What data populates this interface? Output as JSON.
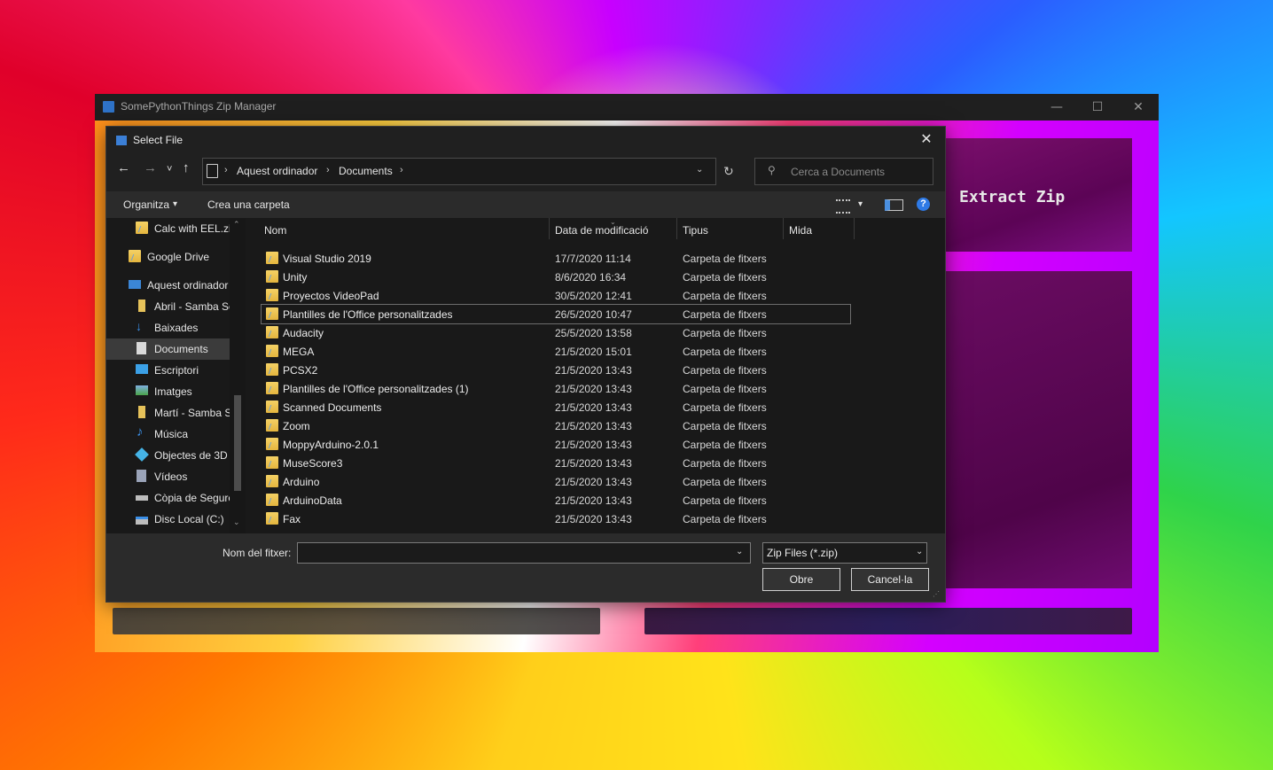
{
  "app": {
    "title": "SomePythonThings Zip Manager",
    "minimize": "—",
    "maximize": "☐",
    "close": "✕",
    "extract_label": "Extract Zip"
  },
  "dialog": {
    "title": "Select File",
    "close": "✕",
    "nav": {
      "back": "←",
      "forward": "→",
      "recent": "˅",
      "up": "↑",
      "refresh": "↻"
    },
    "address": {
      "crumbs": [
        "Aquest ordinador",
        "Documents"
      ],
      "sep": "›"
    },
    "search": {
      "placeholder": "Cerca a Documents"
    },
    "toolbar": {
      "organize": "Organitza",
      "organize_arrow": "▾",
      "new_folder": "Crea una carpeta",
      "view_arrow": "▾",
      "help": "?"
    },
    "nav_pane": [
      {
        "label": "Calc with EEL.zip",
        "icon": "zip-folder-icon"
      },
      {
        "label": "Google Drive",
        "icon": "folder-icon"
      },
      {
        "label": "Aquest ordinador",
        "icon": "computer-icon"
      },
      {
        "label": "Abril - Samba Se",
        "icon": "network-folder-icon"
      },
      {
        "label": "Baixades",
        "icon": "download-icon"
      },
      {
        "label": "Documents",
        "icon": "documents-icon",
        "selected": true
      },
      {
        "label": "Escriptori",
        "icon": "desktop-icon"
      },
      {
        "label": "Imatges",
        "icon": "pictures-icon"
      },
      {
        "label": "Martí - Samba Se",
        "icon": "network-folder-icon"
      },
      {
        "label": "Música",
        "icon": "music-icon"
      },
      {
        "label": "Objectes de 3D",
        "icon": "3d-objects-icon"
      },
      {
        "label": "Vídeos",
        "icon": "videos-icon"
      },
      {
        "label": "Còpia de Segure",
        "icon": "drive-icon"
      },
      {
        "label": "Disc Local (C:)",
        "icon": "drive-icon"
      }
    ],
    "columns": {
      "name": "Nom",
      "date": "Data de modificació",
      "type": "Tipus",
      "size": "Mida"
    },
    "files": [
      {
        "name": "Visual Studio 2019",
        "date": "17/7/2020 11:14",
        "type": "Carpeta de fitxers"
      },
      {
        "name": "Unity",
        "date": "8/6/2020 16:34",
        "type": "Carpeta de fitxers"
      },
      {
        "name": "Proyectos VideoPad",
        "date": "30/5/2020 12:41",
        "type": "Carpeta de fitxers"
      },
      {
        "name": "Plantilles de l'Office personalitzades",
        "date": "26/5/2020 10:47",
        "type": "Carpeta de fitxers",
        "selected": true
      },
      {
        "name": "Audacity",
        "date": "25/5/2020 13:58",
        "type": "Carpeta de fitxers"
      },
      {
        "name": "MEGA",
        "date": "21/5/2020 15:01",
        "type": "Carpeta de fitxers"
      },
      {
        "name": "PCSX2",
        "date": "21/5/2020 13:43",
        "type": "Carpeta de fitxers"
      },
      {
        "name": "Plantilles de l'Office personalitzades (1)",
        "date": "21/5/2020 13:43",
        "type": "Carpeta de fitxers"
      },
      {
        "name": "Scanned Documents",
        "date": "21/5/2020 13:43",
        "type": "Carpeta de fitxers"
      },
      {
        "name": "Zoom",
        "date": "21/5/2020 13:43",
        "type": "Carpeta de fitxers"
      },
      {
        "name": "MoppyArduino-2.0.1",
        "date": "21/5/2020 13:43",
        "type": "Carpeta de fitxers"
      },
      {
        "name": "MuseScore3",
        "date": "21/5/2020 13:43",
        "type": "Carpeta de fitxers"
      },
      {
        "name": "Arduino",
        "date": "21/5/2020 13:43",
        "type": "Carpeta de fitxers"
      },
      {
        "name": "ArduinoData",
        "date": "21/5/2020 13:43",
        "type": "Carpeta de fitxers"
      },
      {
        "name": "Fax",
        "date": "21/5/2020 13:43",
        "type": "Carpeta de fitxers"
      }
    ],
    "filename": {
      "label": "Nom del fitxer:",
      "value": "",
      "arrow": "⌄"
    },
    "filter": {
      "value": "Zip Files (*.zip)",
      "arrow": "⌄"
    },
    "open_button": "Obre",
    "cancel_button": "Cancel·la"
  }
}
